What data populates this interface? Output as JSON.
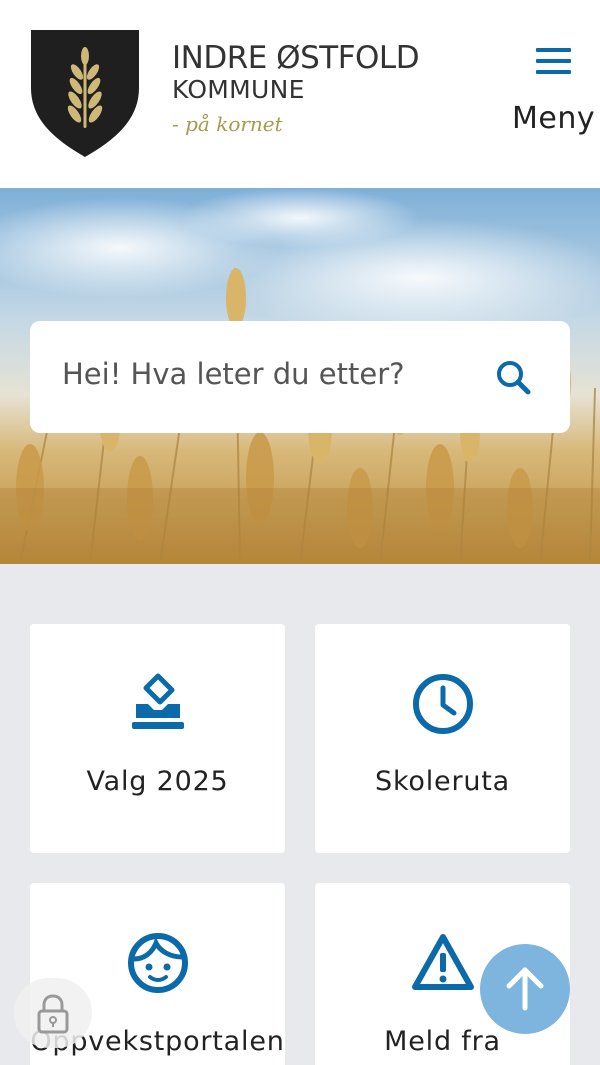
{
  "header": {
    "brand_title": "INDRE ØSTFOLD",
    "brand_subtitle": "KOMMUNE",
    "brand_tagline": "- på kornet",
    "menu_label": "Meny"
  },
  "search": {
    "placeholder": "Hei! Hva leter du etter?"
  },
  "tiles": [
    {
      "label": "Valg 2025",
      "icon": "ballot-box-icon"
    },
    {
      "label": "Skoleruta",
      "icon": "clock-icon"
    },
    {
      "label": "Oppvekstportalen",
      "icon": "child-face-icon"
    },
    {
      "label": "Meld fra",
      "icon": "warning-icon"
    }
  ],
  "colors": {
    "accent": "#0b6aa9",
    "scroll_top_button": "#7eb5df",
    "shield": "#1f1f1f",
    "wheat_gold": "#c9b173",
    "page_background": "#e8e9ec"
  }
}
